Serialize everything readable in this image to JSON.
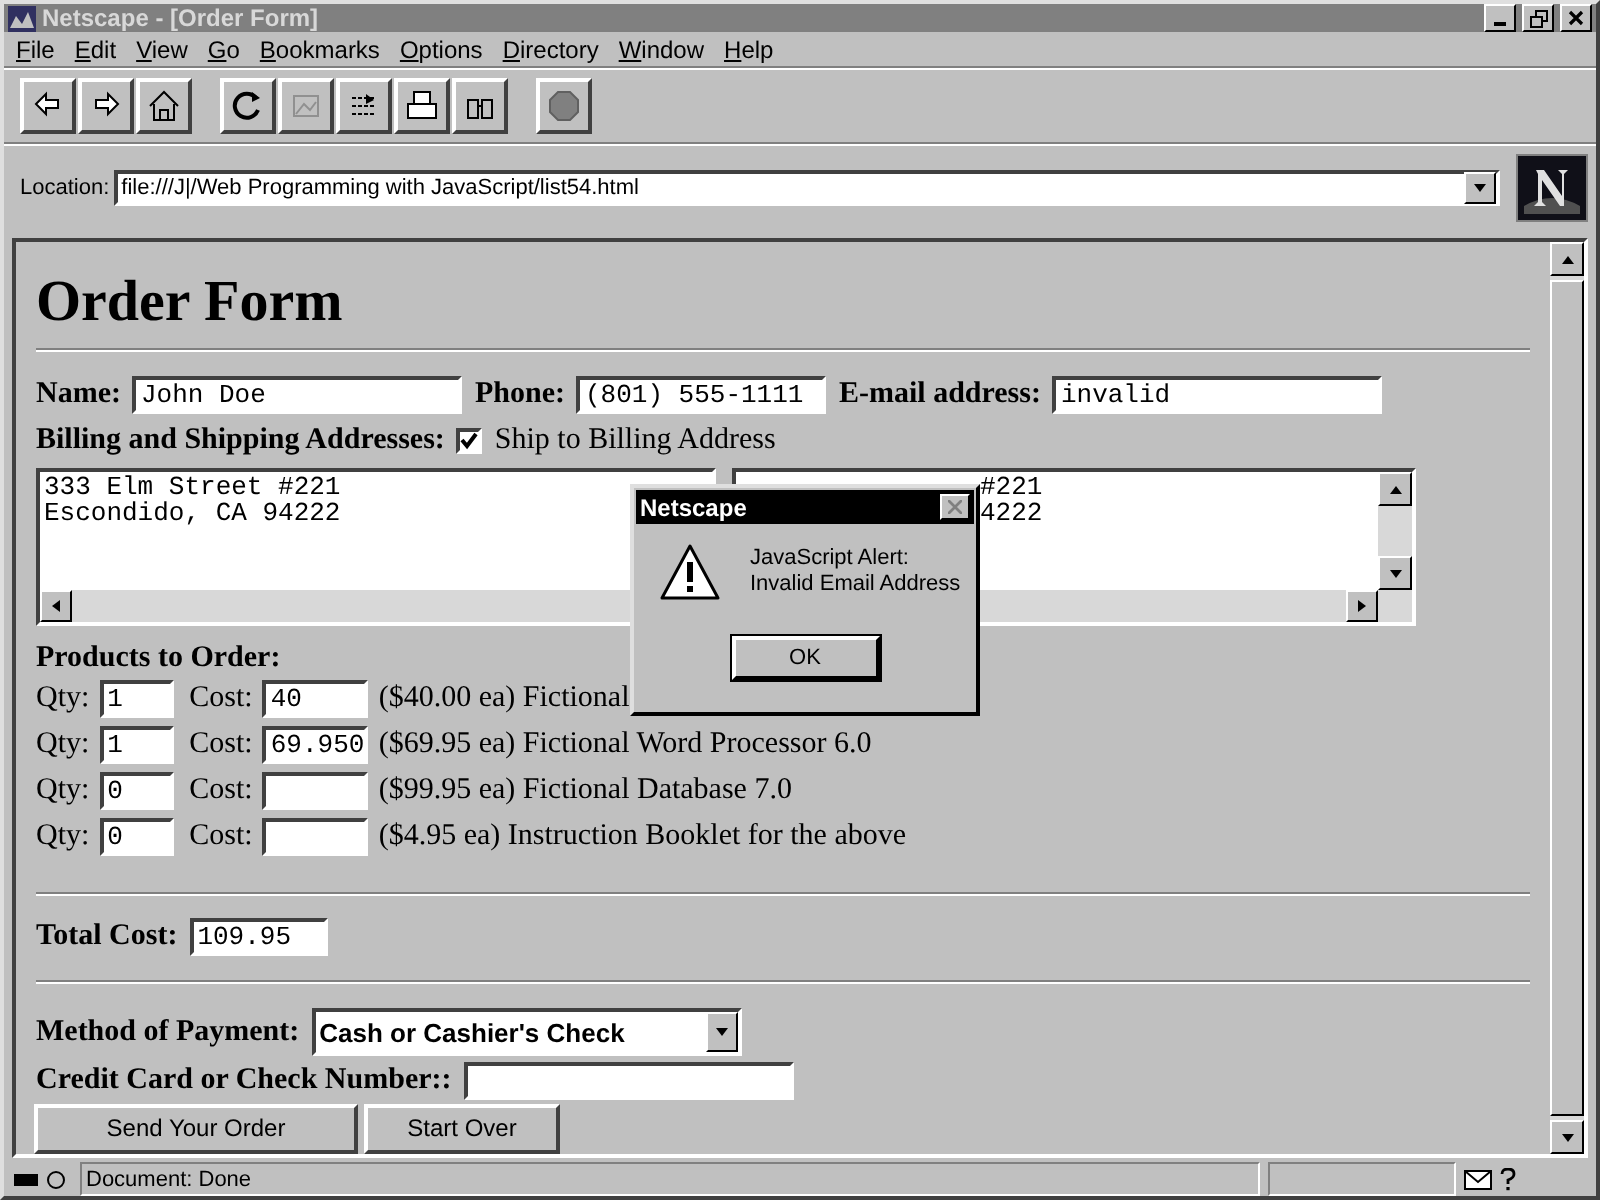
{
  "window": {
    "title": "Netscape - [Order Form]"
  },
  "menu": [
    {
      "label": "File"
    },
    {
      "label": "Edit"
    },
    {
      "label": "View"
    },
    {
      "label": "Go"
    },
    {
      "label": "Bookmarks"
    },
    {
      "label": "Options"
    },
    {
      "label": "Directory"
    },
    {
      "label": "Window"
    },
    {
      "label": "Help"
    }
  ],
  "toolbar": [
    [
      {
        "kind": "back",
        "disabled": false
      },
      {
        "kind": "forward",
        "disabled": false
      },
      {
        "kind": "home",
        "disabled": false
      }
    ],
    [
      {
        "kind": "reload",
        "disabled": false
      },
      {
        "kind": "images",
        "disabled": true
      },
      {
        "kind": "open",
        "disabled": false
      },
      {
        "kind": "print",
        "disabled": false
      },
      {
        "kind": "find",
        "disabled": false
      }
    ],
    [
      {
        "kind": "stop",
        "disabled": true
      }
    ]
  ],
  "location": {
    "label": "Location:",
    "value": "file:///J|/Web Programming with JavaScript/list54.html"
  },
  "form": {
    "heading": "Order Form",
    "contact": [
      {
        "label": "Name:",
        "value": "John Doe"
      },
      {
        "label": "Phone:",
        "value": "(801) 555-1111"
      },
      {
        "label": "E-mail address:",
        "value": "invalid"
      }
    ],
    "addresses": {
      "label": "Billing and Shipping Addresses:",
      "checkbox": {
        "label": "Ship to Billing Address",
        "checked": true
      },
      "billing": [
        "333 Elm Street #221",
        "Escondido, CA 94222"
      ],
      "shipping": [
        "#221",
        "4222"
      ]
    },
    "products": {
      "label": "Products to Order:",
      "rows": [
        {
          "qty_label": "Qty:",
          "qty": "1",
          "cost_label": "Cost:",
          "cost": "40",
          "description": "($40.00 ea) Fictional"
        },
        {
          "qty_label": "Qty:",
          "qty": "1",
          "cost_label": "Cost:",
          "cost": "69.950",
          "description": "($69.95 ea) Fictional Word Processor 6.0"
        },
        {
          "qty_label": "Qty:",
          "qty": "0",
          "cost_label": "Cost:",
          "description": "($99.95 ea) Fictional Database 7.0"
        },
        {
          "qty_label": "Qty:",
          "qty": "0",
          "cost_label": "Cost:",
          "description": "($4.95 ea) Instruction Booklet for the above"
        }
      ]
    },
    "total": {
      "label": "Total Cost:",
      "value": "109.95"
    },
    "payment": {
      "label": "Method of Payment:",
      "value": "Cash or Cashier's Check"
    },
    "card": {
      "label": "Credit Card or Check Number::"
    },
    "buttons": [
      "Send Your Order",
      "Start Over"
    ]
  },
  "dialog": {
    "title": "Netscape",
    "lines": [
      "JavaScript Alert:",
      "Invalid Email Address"
    ],
    "button": "OK"
  },
  "status_bar": {
    "text": "Document: Done"
  }
}
